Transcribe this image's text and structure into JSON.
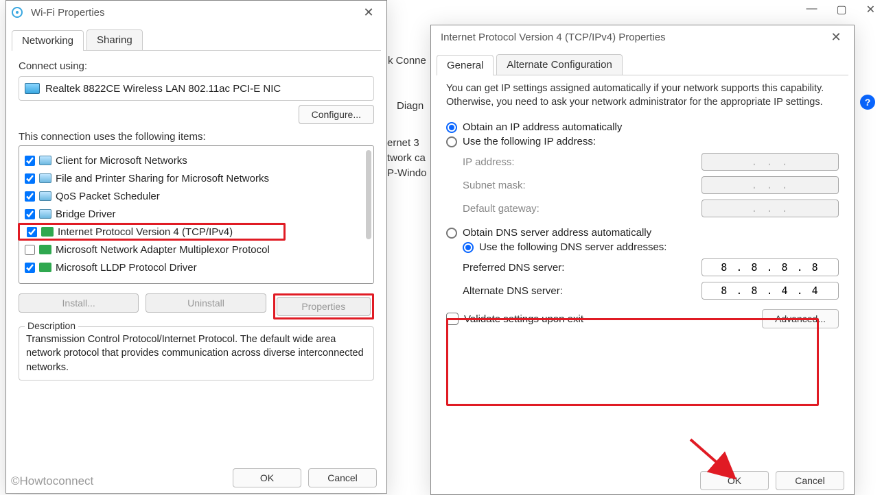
{
  "bgWindow": {
    "conn": "k Conne",
    "diag": "Diagn",
    "eth": "ernet 3",
    "cable": "twork ca",
    "pwind": "P-Windo"
  },
  "wifiDialog": {
    "title": "Wi-Fi Properties",
    "tabs": {
      "networking": "Networking",
      "sharing": "Sharing"
    },
    "connectUsing": "Connect using:",
    "adapter": "Realtek 8822CE Wireless LAN 802.11ac PCI-E NIC",
    "configure": "Configure...",
    "itemsHeader": "This connection uses the following items:",
    "items": [
      {
        "label": "Client for Microsoft Networks",
        "checked": true,
        "iconType": "monitor"
      },
      {
        "label": "File and Printer Sharing for Microsoft Networks",
        "checked": true,
        "iconType": "monitor"
      },
      {
        "label": "QoS Packet Scheduler",
        "checked": true,
        "iconType": "monitor"
      },
      {
        "label": "Bridge Driver",
        "checked": true,
        "iconType": "monitor"
      },
      {
        "label": "Internet Protocol Version 4 (TCP/IPv4)",
        "checked": true,
        "iconType": "green",
        "highlight": true
      },
      {
        "label": "Microsoft Network Adapter Multiplexor Protocol",
        "checked": false,
        "iconType": "green"
      },
      {
        "label": "Microsoft LLDP Protocol Driver",
        "checked": true,
        "iconType": "green"
      }
    ],
    "install": "Install...",
    "uninstall": "Uninstall",
    "propertiesBtn": "Properties",
    "descriptionLegend": "Description",
    "description": "Transmission Control Protocol/Internet Protocol. The default wide area network protocol that provides communication across diverse interconnected networks.",
    "ok": "OK",
    "cancel": "Cancel"
  },
  "ipv4Dialog": {
    "title": "Internet Protocol Version 4 (TCP/IPv4) Properties",
    "tabs": {
      "general": "General",
      "alt": "Alternate Configuration"
    },
    "info": "You can get IP settings assigned automatically if your network supports this capability. Otherwise, you need to ask your network administrator for the appropriate IP settings.",
    "radio": {
      "autoIP": "Obtain an IP address automatically",
      "useIP": "Use the following IP address:",
      "autoDNS": "Obtain DNS server address automatically",
      "useDNS": "Use the following DNS server addresses:"
    },
    "ipLabel": "IP address:",
    "maskLabel": "Subnet mask:",
    "gwLabel": "Default gateway:",
    "prefDnsLabel": "Preferred DNS server:",
    "altDnsLabel": "Alternate DNS server:",
    "emptyIp": ".       .       .",
    "prefDns": "8  .  8  .  8  .  8",
    "altDns": "8  .  8  .  4  .  4",
    "validate": "Validate settings upon exit",
    "advanced": "Advanced...",
    "ok": "OK",
    "cancel": "Cancel"
  },
  "watermark": "©Howtoconnect"
}
